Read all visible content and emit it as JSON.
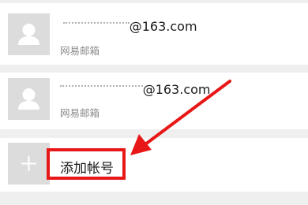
{
  "accounts": [
    {
      "email_visible_suffix": "@163.com",
      "provider_label": "网易邮箱"
    },
    {
      "email_visible_suffix": "@163.com",
      "provider_label": "网易邮箱"
    }
  ],
  "add_account": {
    "label": "添加帐号"
  },
  "annotation": {
    "highlight_color": "#e81717"
  },
  "icons": {
    "avatar": "person-placeholder-icon",
    "add": "plus-icon"
  }
}
